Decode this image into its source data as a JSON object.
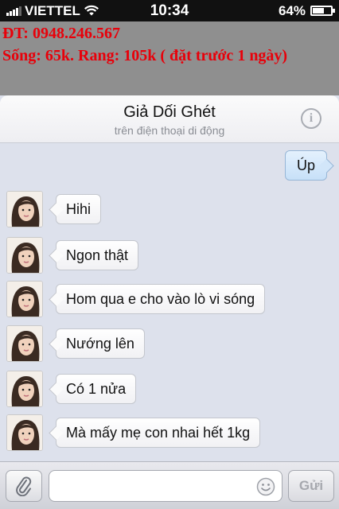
{
  "status_bar": {
    "carrier": "VIETTEL",
    "time": "10:34",
    "battery_percent": "64%",
    "battery_level": 0.64,
    "icons": [
      "signal-bars-icon",
      "wifi-icon",
      "battery-icon"
    ]
  },
  "ad": {
    "line1": "ĐT: 0948.246.567",
    "line2": "Sống: 65k. Rang: 105k ( đặt trước 1 ngày)",
    "color": "#e8000a"
  },
  "chat_header": {
    "contact_name": "Giả Dối Ghét",
    "subtitle": "trên điện thoại di động",
    "info_icon": "info-icon"
  },
  "messages": [
    {
      "direction": "outgoing",
      "text": "Úp"
    },
    {
      "direction": "incoming",
      "text": "Hihi"
    },
    {
      "direction": "incoming",
      "text": "Ngon thật"
    },
    {
      "direction": "incoming",
      "text": "Hom qua e cho vào lò vi sóng"
    },
    {
      "direction": "incoming",
      "text": "Nướng lên"
    },
    {
      "direction": "incoming",
      "text": "Có 1 nửa"
    },
    {
      "direction": "incoming",
      "text": "Mà mấy mẹ con nhai hết 1kg"
    }
  ],
  "input_bar": {
    "attach_icon": "paperclip-icon",
    "emoji_icon": "smiley-icon",
    "input_value": "",
    "send_label": "Gửi"
  }
}
